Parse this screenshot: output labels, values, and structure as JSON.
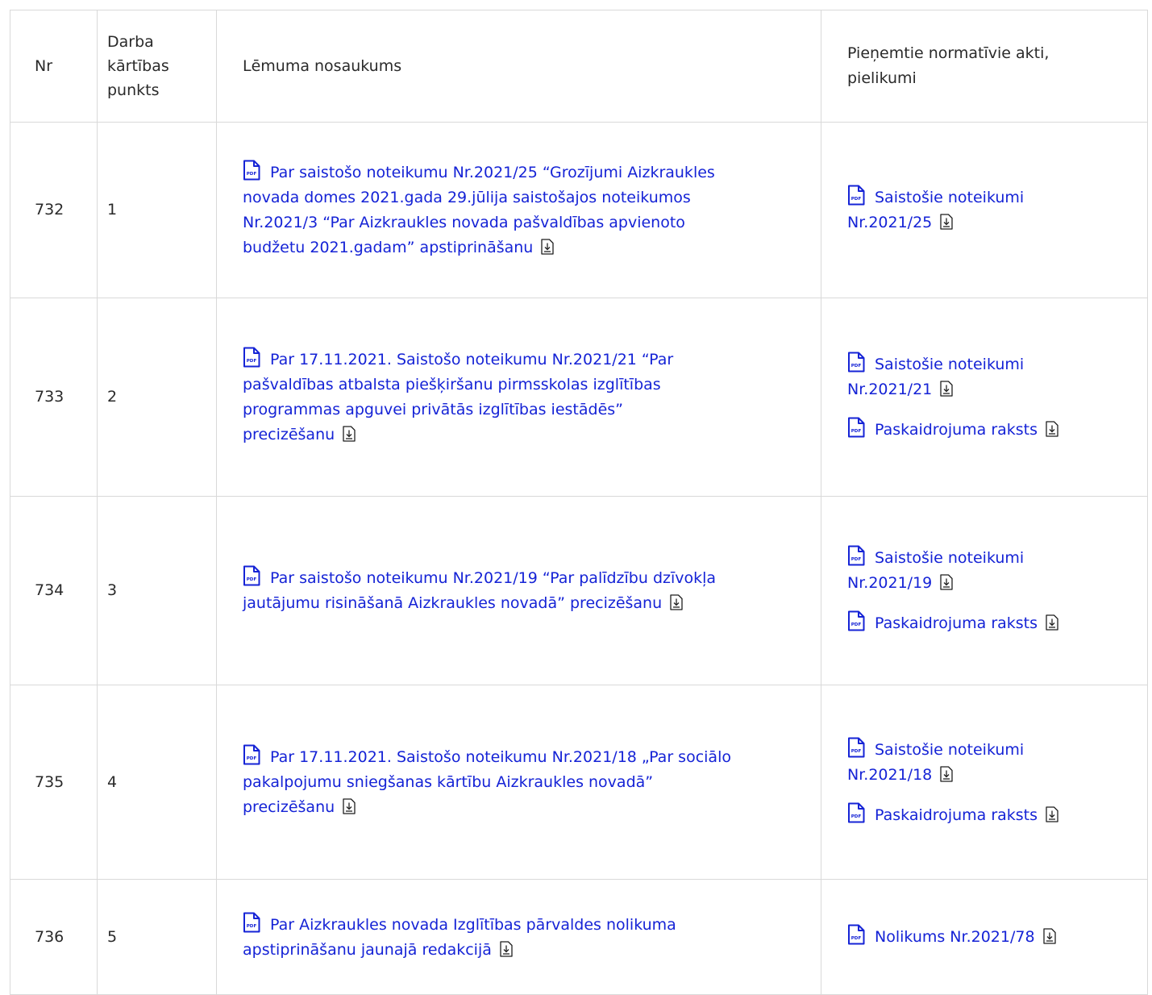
{
  "table": {
    "headers": {
      "nr": "Nr",
      "point": [
        "Darba",
        "kārtības",
        "punkts"
      ],
      "title": "Lēmuma nosaukums",
      "acts": [
        "Pieņemtie normatīvie akti,",
        "pielikumi"
      ]
    },
    "rows": [
      {
        "nr": "732",
        "point": "1",
        "title_lines": [
          "Par saistošo noteikumu Nr.2021/25 “Grozījumi Aizkraukles",
          "novada domes 2021.gada 29.jūlija saistošajos noteikumos",
          "Nr.2021/3 “Par Aizkraukles novada pašvaldības apvienoto",
          "budžetu 2021.gadam” apstiprināšanu"
        ],
        "acts": [
          {
            "lines": [
              "Saistošie noteikumi",
              "Nr.2021/25"
            ]
          }
        ]
      },
      {
        "nr": "733",
        "point": "2",
        "title_lines": [
          "Par 17.11.2021. Saistošo noteikumu Nr.2021/21 “Par",
          "pašvaldības atbalsta piešķiršanu pirmsskolas izglītības",
          "programmas apguvei privātās izglītības iestādēs”",
          "precizēšanu"
        ],
        "acts": [
          {
            "lines": [
              "Saistošie noteikumi",
              "Nr.2021/21"
            ]
          },
          {
            "lines": [
              "Paskaidrojuma raksts"
            ]
          }
        ]
      },
      {
        "nr": "734",
        "point": "3",
        "title_lines": [
          "Par saistošo noteikumu Nr.2021/19 “Par palīdzību dzīvokļa",
          "jautājumu risināšanā Aizkraukles novadā” precizēšanu"
        ],
        "acts": [
          {
            "lines": [
              "Saistošie noteikumi",
              "Nr.2021/19"
            ]
          },
          {
            "lines": [
              "Paskaidrojuma raksts"
            ]
          }
        ]
      },
      {
        "nr": "735",
        "point": "4",
        "title_lines": [
          "Par 17.11.2021. Saistošo noteikumu Nr.2021/18 „Par sociālo",
          "pakalpojumu sniegšanas kārtību Aizkraukles novadā”",
          "precizēšanu"
        ],
        "acts": [
          {
            "lines": [
              "Saistošie noteikumi",
              "Nr.2021/18"
            ]
          },
          {
            "lines": [
              "Paskaidrojuma raksts"
            ]
          }
        ]
      },
      {
        "nr": "736",
        "point": "5",
        "title_lines": [
          "Par Aizkraukles novada Izglītības pārvaldes nolikuma",
          "apstiprināšanu jaunajā redakcijā"
        ],
        "acts": [
          {
            "lines": [
              "Nolikums Nr.2021/78"
            ]
          }
        ]
      }
    ]
  },
  "icons": {
    "file": "pdf-file-icon",
    "download": "download-icon",
    "file_badge": "PDF"
  },
  "colors": {
    "link": "#1523d6",
    "border": "#d9d9d9",
    "text": "#2a2a2a"
  }
}
